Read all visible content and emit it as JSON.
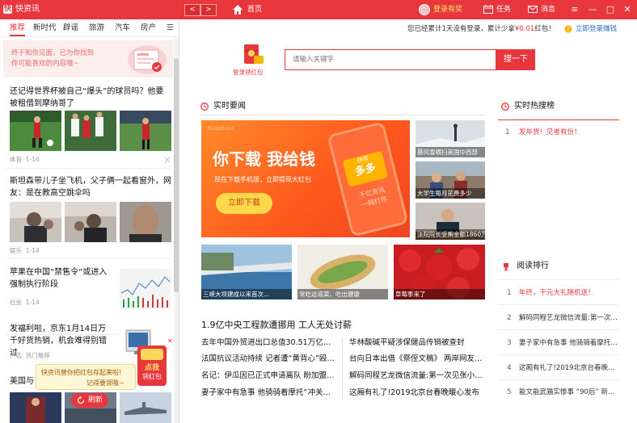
{
  "titlebar": {
    "app_name": "快资讯",
    "nav_back": "<",
    "nav_forward": ">",
    "home_label": "首页",
    "login_label": "登录有奖",
    "tasks_label": "任务",
    "messages_label": "消息",
    "win_menu": "≡",
    "win_min": "—",
    "win_max": "□",
    "win_close": "✕"
  },
  "tabs": [
    "推荐",
    "新时代",
    "辟谣",
    "旅游",
    "汽车",
    "房产",
    "☰"
  ],
  "banner": {
    "line1": "终于和你见面，已为你找到",
    "line2": "你可能喜欢的内容哦~"
  },
  "feed": [
    {
      "title": "还记得世界杯被自己“爆头”的球员吗？他要被租借到摩纳哥了",
      "source": "体育",
      "time": "1-14"
    },
    {
      "title": "斯坦森带儿子坐飞机，父子俩一起看窗外，网友：是在教高空跳伞吗",
      "source": "娱乐",
      "time": "1-14"
    },
    {
      "title": "苹果在中国“禁售令”或进入强制执行阶段",
      "source": "社会",
      "time": "1-14"
    },
    {
      "title": "发福利啦，京东1月14日万千好货热销，机会难得别错过",
      "source": "广告",
      "time": "热门推荐"
    },
    {
      "title": "美国与"
    }
  ],
  "popup": {
    "line1": "快资讯替你把红包存起来啦!",
    "line2": "记得要领哦~",
    "badge_top": "点我",
    "badge_bottom": "领红包",
    "close": "✕"
  },
  "refresh_label": "刷新",
  "header": {
    "notice_prefix": "您已经累计1天没有登录，累计少拿",
    "notice_amount": "¥0.01",
    "notice_suffix": "红包！",
    "login_link": "立即登录赚钱"
  },
  "redpack_label": "登录领红包",
  "search": {
    "placeholder": "请输入关键字",
    "button": "搜一下"
  },
  "realtime": {
    "title": "实时要闻",
    "promo_title": "你下载 我给钱",
    "promo_sub": "现在下载手机版，立即提现大红包",
    "promo_btn": "立即下载",
    "promo_brand": "Kuaizixun",
    "phone_tag1": "快资",
    "phone_tag2": "多多",
    "phone_tag3": "千亿资讯",
    "phone_tag4": "一网打尽"
  },
  "side_images": [
    "暴风雪横扫美国中西部",
    "大学生每月花费多少",
    "法院院长受贿金额1860万",
    "三峡大坝建成以来首次…",
    "常吃这道菜，吃出健康",
    "草莓季来了"
  ],
  "headline": "1.9亿中央工程款遭挪用 工人无处讨薪",
  "news_left": [
    "去年中国外贸进出口总值30.51万亿…",
    "法国抗议活动持续 记者遭“黄背心”殴…",
    "名记：伊瓜因已正式申请离队 盼加盟…",
    "妻子家中有急事 他骑骑着摩托“冲关…"
  ],
  "news_right": [
    "华林酸碱平疑涉保健品传销被查封",
    "台向日本出借《祭侄文稿》 两岸网友…",
    "解码同程艺龙微信流量:第一次见张小…",
    "这厢有礼了!2019北京台春晚暖心发布"
  ],
  "hot": {
    "title": "实时热搜榜",
    "items": [
      {
        "rank": "1",
        "text": "发年货！见者有份！"
      }
    ]
  },
  "reading": {
    "title": "阅读排行",
    "items": [
      {
        "rank": "1",
        "text": "年终，千元大礼随机送！"
      },
      {
        "rank": "2",
        "text": "解码同程艺龙微信流量:第一次…"
      },
      {
        "rank": "3",
        "text": "妻子家中有急事 他骑骑着摩托…"
      },
      {
        "rank": "4",
        "text": "这厢有礼了!2019北京台春晚…"
      },
      {
        "rank": "5",
        "text": "能文能武猫实惨事 “90后” 新…"
      }
    ]
  },
  "colors": {
    "brand_red": "#e8373c",
    "highlight_red": "#e8373c",
    "light_red": "#fdeeee"
  }
}
